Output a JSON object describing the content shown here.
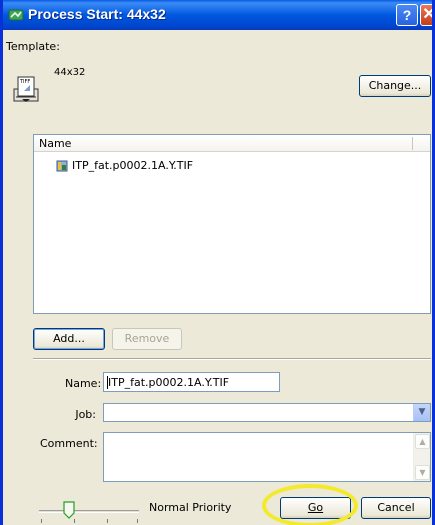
{
  "window": {
    "title": "Process Start: 44x32",
    "help_button": "?",
    "close_button": "✕"
  },
  "template": {
    "label": "Template:",
    "name": "44x32",
    "icon_text": "TIFF",
    "change_button": "Change..."
  },
  "file_list": {
    "column_header": "Name",
    "items": [
      {
        "name": "ITP_fat.p0002.1A.Y.TIF"
      }
    ]
  },
  "list_buttons": {
    "add": "Add...",
    "remove": "Remove"
  },
  "form": {
    "name_label": "Name:",
    "name_value": "ITP_fat.p0002.1A.Y.TIF",
    "job_label": "Job:",
    "job_value": "",
    "comment_label": "Comment:",
    "comment_value": ""
  },
  "priority": {
    "label": "Normal Priority"
  },
  "actions": {
    "go": "Go",
    "cancel": "Cancel"
  },
  "colors": {
    "titlebar": "#0058e0",
    "dialog_bg": "#ece9d8",
    "highlight_circle": "#f2ea2a"
  }
}
